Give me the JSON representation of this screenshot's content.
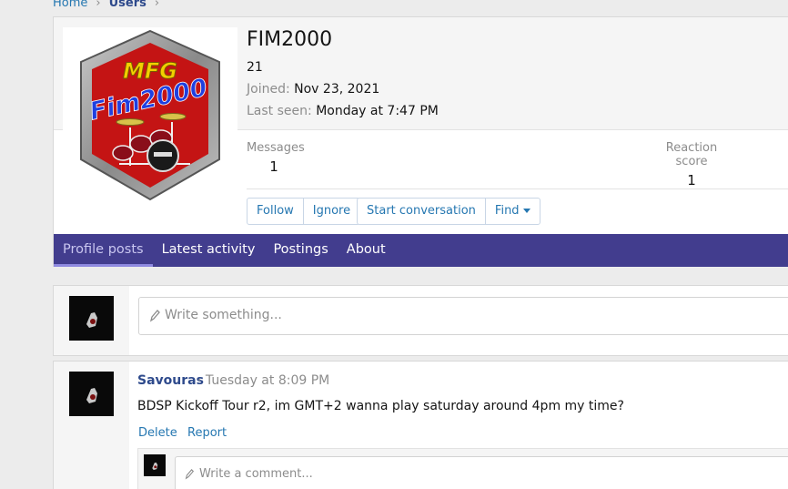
{
  "breadcrumb": {
    "home": "Home",
    "users": "Users"
  },
  "profile": {
    "avatar_text_top": "MFG",
    "avatar_text_main": "Fim2000",
    "name": "FIM2000",
    "title": "21",
    "joined_label": "Joined:",
    "joined_value": "Nov 23, 2021",
    "lastseen_label": "Last seen:",
    "lastseen_value": "Monday at 7:47 PM",
    "stats": {
      "messages_label": "Messages",
      "messages_value": "1",
      "reaction_label": "Reaction score",
      "reaction_value": "1"
    },
    "buttons": {
      "follow": "Follow",
      "ignore": "Ignore",
      "start_conversation": "Start conversation",
      "find": "Find"
    }
  },
  "tabs": [
    "Profile posts",
    "Latest activity",
    "Postings",
    "About"
  ],
  "composer": {
    "placeholder": "Write something..."
  },
  "post": {
    "author": "Savouras",
    "time": "· Tuesday at 8:09 PM",
    "body": "BDSP Kickoff Tour r2, im GMT+2 wanna play saturday around 4pm my time?",
    "delete": "Delete",
    "report": "Report",
    "comment_placeholder": "Write a comment..."
  },
  "colors": {
    "nav_bg": "#423d8e",
    "link": "#2577b1",
    "author": "#2e4a8c"
  }
}
